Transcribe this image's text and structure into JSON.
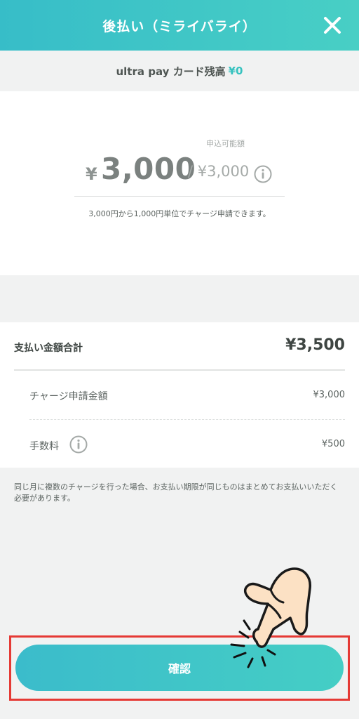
{
  "header": {
    "title": "後払い（ミライバライ）",
    "close_icon": "close-icon"
  },
  "balance": {
    "label": "ultra pay カード残高",
    "amount": "¥0"
  },
  "charge": {
    "currency_symbol": "¥",
    "amount": "3,000",
    "limit_label": "申込可能額",
    "limit_value": "/ ¥3,000",
    "note": "3,000円から1,000円単位でチャージ申請できます。"
  },
  "summary": {
    "total_label": "支払い金額合計",
    "total_value": "¥3,500",
    "charge_label": "チャージ申請金額",
    "charge_value": "¥3,000",
    "fee_label": "手数料",
    "fee_value": "¥500"
  },
  "footnote": "同じ月に複数のチャージを行った場合、お支払い期限が同じものはまとめてお支払いいただく必要があります。",
  "confirm_button": {
    "label": "確認"
  },
  "colors": {
    "accent": "#36c2bf",
    "header_gradient_start": "#37bdc8",
    "header_gradient_end": "#48cfc5",
    "highlight": "#e53a35"
  }
}
